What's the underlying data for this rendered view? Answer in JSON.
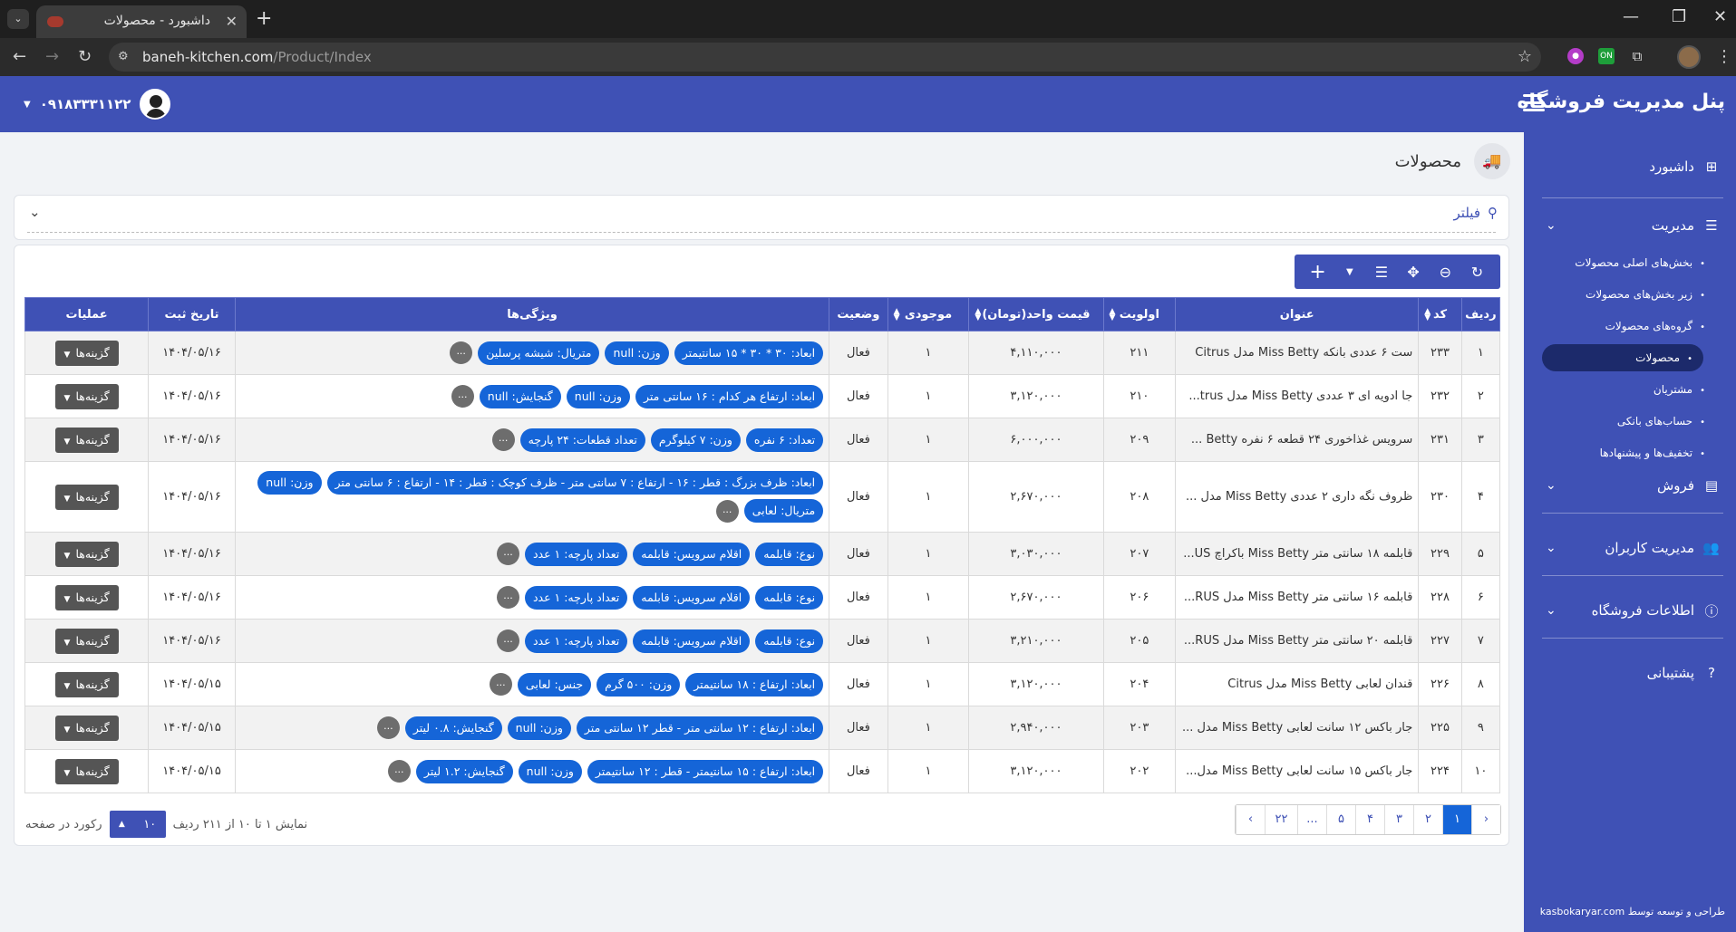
{
  "browser": {
    "tab_title": "داشبورد - محصولات",
    "url_host": "baneh-kitchen.com",
    "url_path": "/Product/Index"
  },
  "header": {
    "brand": "پنل مدیریت فروشگاه",
    "user_phone": "۰۹۱۸۳۳۳۱۱۲۲"
  },
  "sidebar": {
    "dashboard": "داشبورد",
    "management": "مدیریت",
    "sub_items": [
      "بخش‌های اصلی محصولات",
      "زیر بخش‌های محصولات",
      "گروه‌های محصولات",
      "محصولات",
      "مشتریان",
      "حساب‌های بانکی",
      "تخفیف‌ها و پیشنهادها"
    ],
    "sales": "فروش",
    "users_mgmt": "مدیریت کاربران",
    "store_info": "اطلاعات فروشگاه",
    "support": "پشتیبانی",
    "footer": "طراحی و توسعه توسط kasbokaryar.com"
  },
  "page": {
    "title": "محصولات",
    "filter_label": "فیلتر"
  },
  "table": {
    "columns": {
      "row": "ردیف",
      "code": "کد",
      "title": "عنوان",
      "priority": "اولویت",
      "price": "قیمت واحد(تومان)",
      "stock": "موجودی",
      "status": "وضعیت",
      "features": "ویژگی‌ها",
      "date": "تاریخ ثبت",
      "actions": "عملیات"
    },
    "options_label": "گزینه‌ها",
    "more_label": "...",
    "rows": [
      {
        "row": "۱",
        "code": "۲۳۳",
        "title": "ست ۶ عددی بانکه Miss Betty مدل Citrus",
        "priority": "۲۱۱",
        "price": "۴,۱۱۰,۰۰۰",
        "stock": "۱",
        "status": "فعال",
        "date": "۱۴۰۴/۰۵/۱۶",
        "chips": [
          "ابعاد: ۳۰ * ۳۰ * ۱۵ سانتیمتر",
          "وزن: null",
          "متریال: شیشه پرسلین"
        ]
      },
      {
        "row": "۲",
        "code": "۲۳۲",
        "title": "جا ادویه ای ۳ عددی Miss Betty مدل trus...",
        "priority": "۲۱۰",
        "price": "۳,۱۲۰,۰۰۰",
        "stock": "۱",
        "status": "فعال",
        "date": "۱۴۰۴/۰۵/۱۶",
        "chips": [
          "ابعاد: ارتفاع هر کدام : ۱۶ سانتی متر",
          "وزن: null",
          "گنجایش: null"
        ]
      },
      {
        "row": "۳",
        "code": "۲۳۱",
        "title": "سرویس غذاخوری ۲۴ قطعه ۶ نفره Betty ...",
        "priority": "۲۰۹",
        "price": "۶,۰۰۰,۰۰۰",
        "stock": "۱",
        "status": "فعال",
        "date": "۱۴۰۴/۰۵/۱۶",
        "chips": [
          "تعداد: ۶ نفره",
          "وزن: ۷ کیلوگرم",
          "تعداد قطعات: ۲۴ پارچه"
        ]
      },
      {
        "row": "۴",
        "code": "۲۳۰",
        "title": "ظروف نگه داری ۲ عددی Miss Betty مدل ...",
        "priority": "۲۰۸",
        "price": "۲,۶۷۰,۰۰۰",
        "stock": "۱",
        "status": "فعال",
        "date": "۱۴۰۴/۰۵/۱۶",
        "chips": [
          "ابعاد: ظرف بزرگ : قطر : ۱۶ - ارتفاع : ۷ سانتی متر - ظرف کوچک : قطر : ۱۴ - ارتفاع : ۶ سانتی متر",
          "وزن: null",
          "متریال: لعابی"
        ]
      },
      {
        "row": "۵",
        "code": "۲۲۹",
        "title": "قابلمه ۱۸ سانتی متر Miss Betty باکراچ US...",
        "priority": "۲۰۷",
        "price": "۳,۰۳۰,۰۰۰",
        "stock": "۱",
        "status": "فعال",
        "date": "۱۴۰۴/۰۵/۱۶",
        "chips": [
          "نوع: قابلمه",
          "اقلام سرویس: قابلمه",
          "تعداد پارچه: ۱ عدد"
        ]
      },
      {
        "row": "۶",
        "code": "۲۲۸",
        "title": "قابلمه ۱۶ سانتی متر Miss Betty مدل RUS...",
        "priority": "۲۰۶",
        "price": "۲,۶۷۰,۰۰۰",
        "stock": "۱",
        "status": "فعال",
        "date": "۱۴۰۴/۰۵/۱۶",
        "chips": [
          "نوع: قابلمه",
          "اقلام سرویس: قابلمه",
          "تعداد پارچه: ۱ عدد"
        ]
      },
      {
        "row": "۷",
        "code": "۲۲۷",
        "title": "قابلمه ۲۰ سانتی متر Miss Betty مدل RUS...",
        "priority": "۲۰۵",
        "price": "۳,۲۱۰,۰۰۰",
        "stock": "۱",
        "status": "فعال",
        "date": "۱۴۰۴/۰۵/۱۶",
        "chips": [
          "نوع: قابلمه",
          "اقلام سرویس: قابلمه",
          "تعداد پارچه: ۱ عدد"
        ]
      },
      {
        "row": "۸",
        "code": "۲۲۶",
        "title": "قندان لعابی Miss Betty مدل Citrus",
        "priority": "۲۰۴",
        "price": "۳,۱۲۰,۰۰۰",
        "stock": "۱",
        "status": "فعال",
        "date": "۱۴۰۴/۰۵/۱۵",
        "chips": [
          "ابعاد: ارتفاع : ۱۸ سانتیمتر",
          "وزن: ۵۰۰ گرم",
          "جنس: لعابی"
        ]
      },
      {
        "row": "۹",
        "code": "۲۲۵",
        "title": "جار باکس ۱۲ سانت لعابی Miss Betty مدل ...",
        "priority": "۲۰۳",
        "price": "۲,۹۴۰,۰۰۰",
        "stock": "۱",
        "status": "فعال",
        "date": "۱۴۰۴/۰۵/۱۵",
        "chips": [
          "ابعاد: ارتفاع : ۱۲ سانتی متر - قطر ۱۲ سانتی متر",
          "وزن: null",
          "گنجایش: ۰.۸ لیتر"
        ]
      },
      {
        "row": "۱۰",
        "code": "۲۲۴",
        "title": "جار باکس ۱۵ سانت لعابی Miss Betty مدل...",
        "priority": "۲۰۲",
        "price": "۳,۱۲۰,۰۰۰",
        "stock": "۱",
        "status": "فعال",
        "date": "۱۴۰۴/۰۵/۱۵",
        "chips": [
          "ابعاد: ارتفاع : ۱۵ سانتیمتر - قطر : ۱۲ سانتیمتر",
          "وزن: null",
          "گنجایش: ۱.۲ لیتر"
        ]
      }
    ]
  },
  "pagination": {
    "info": "نمایش ۱ تا ۱۰ از ۲۱۱ ردیف",
    "page_size": "۱۰",
    "per_page_label": "رکورد در صفحه",
    "prev": "‹",
    "pages": [
      "۱",
      "۲",
      "۳",
      "۴",
      "۵",
      "...",
      "۲۲"
    ],
    "next": "›"
  },
  "colors": {
    "primary": "#3f51b5",
    "chip": "#1565d8",
    "status_active": "#2e7d32"
  }
}
